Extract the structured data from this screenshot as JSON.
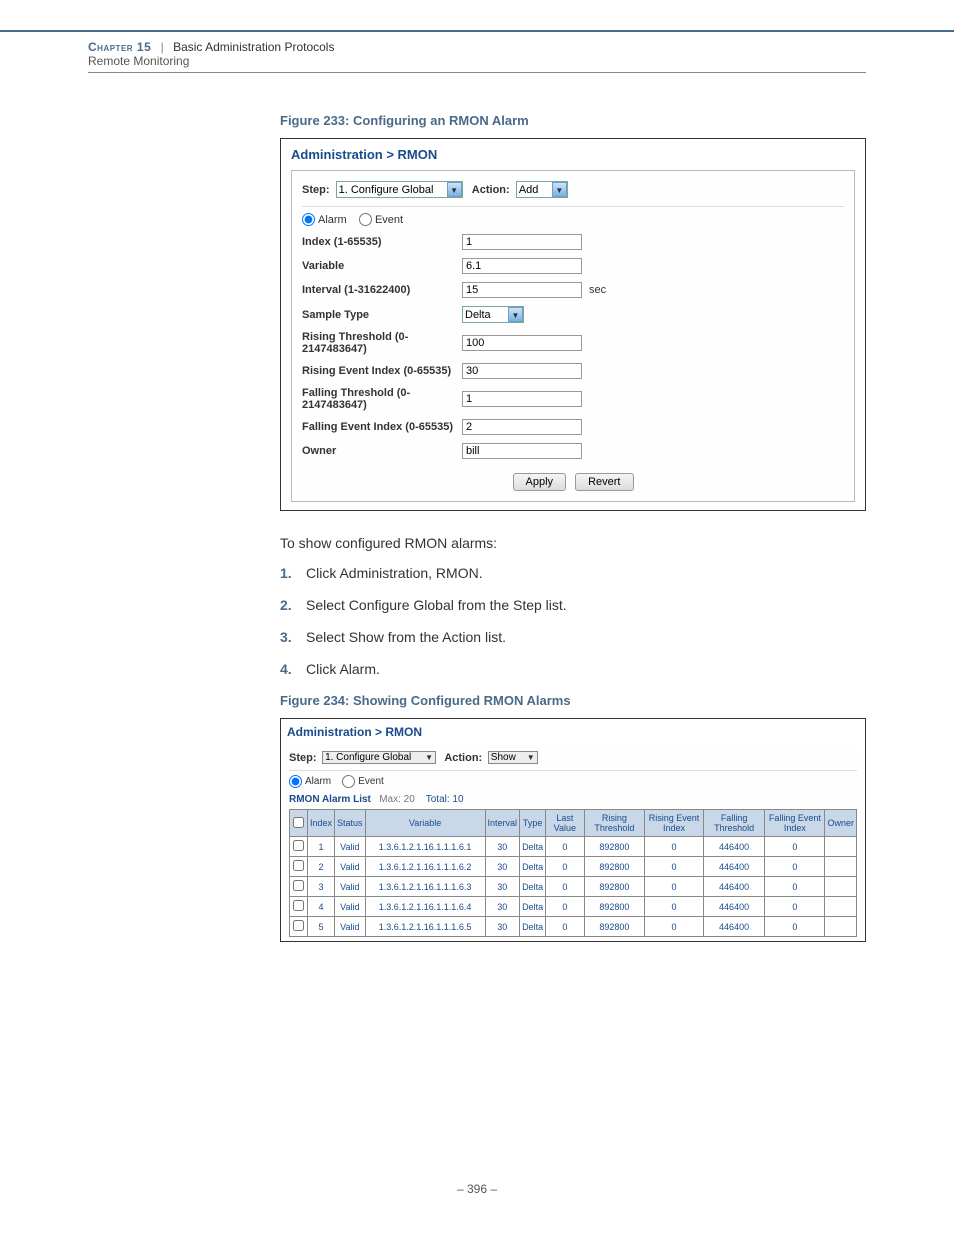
{
  "header": {
    "chapter_label": "Chapter 15",
    "section": "Basic Administration Protocols",
    "subtitle": "Remote Monitoring"
  },
  "fig233": {
    "caption": "Figure 233:  Configuring an RMON Alarm",
    "breadcrumb": "Administration > RMON",
    "step_label": "Step:",
    "step_value": "1. Configure Global",
    "action_label": "Action:",
    "action_value": "Add",
    "radio_alarm": "Alarm",
    "radio_event": "Event",
    "fields": {
      "index_label": "Index (1-65535)",
      "index_value": "1",
      "variable_label": "Variable",
      "variable_value": "6.1",
      "interval_label": "Interval (1-31622400)",
      "interval_value": "15",
      "interval_unit": "sec",
      "sample_label": "Sample Type",
      "sample_value": "Delta",
      "rthresh_label": "Rising Threshold (0-2147483647)",
      "rthresh_value": "100",
      "revent_label": "Rising Event Index (0-65535)",
      "revent_value": "30",
      "fthresh_label": "Falling Threshold (0-2147483647)",
      "fthresh_value": "1",
      "fevent_label": "Falling Event Index (0-65535)",
      "fevent_value": "2",
      "owner_label": "Owner",
      "owner_value": "bill"
    },
    "btn_apply": "Apply",
    "btn_revert": "Revert"
  },
  "instructions": {
    "intro": "To show configured RMON alarms:",
    "s1": "Click Administration, RMON.",
    "s2": "Select Configure Global from the Step list.",
    "s3": "Select Show from the Action list.",
    "s4": "Click Alarm."
  },
  "fig234": {
    "caption": "Figure 234:  Showing Configured RMON Alarms",
    "breadcrumb": "Administration > RMON",
    "step_label": "Step:",
    "step_value": "1. Configure Global",
    "action_label": "Action:",
    "action_value": "Show",
    "radio_alarm": "Alarm",
    "radio_event": "Event",
    "list_title": "RMON Alarm List",
    "list_max": "Max: 20",
    "list_total": "Total: 10",
    "cols": {
      "c1": "Index",
      "c2": "Status",
      "c3": "Variable",
      "c4": "Interval",
      "c5": "Type",
      "c6": "Last Value",
      "c7": "Rising Threshold",
      "c8": "Rising Event Index",
      "c9": "Falling Threshold",
      "c10": "Falling Event Index",
      "c11": "Owner"
    },
    "rows": [
      {
        "idx": "1",
        "status": "Valid",
        "var": "1.3.6.1.2.1.16.1.1.1.6.1",
        "intv": "30",
        "type": "Delta",
        "last": "0",
        "rth": "892800",
        "rei": "0",
        "fth": "446400",
        "fei": "0",
        "own": ""
      },
      {
        "idx": "2",
        "status": "Valid",
        "var": "1.3.6.1.2.1.16.1.1.1.6.2",
        "intv": "30",
        "type": "Delta",
        "last": "0",
        "rth": "892800",
        "rei": "0",
        "fth": "446400",
        "fei": "0",
        "own": ""
      },
      {
        "idx": "3",
        "status": "Valid",
        "var": "1.3.6.1.2.1.16.1.1.1.6.3",
        "intv": "30",
        "type": "Delta",
        "last": "0",
        "rth": "892800",
        "rei": "0",
        "fth": "446400",
        "fei": "0",
        "own": ""
      },
      {
        "idx": "4",
        "status": "Valid",
        "var": "1.3.6.1.2.1.16.1.1.1.6.4",
        "intv": "30",
        "type": "Delta",
        "last": "0",
        "rth": "892800",
        "rei": "0",
        "fth": "446400",
        "fei": "0",
        "own": ""
      },
      {
        "idx": "5",
        "status": "Valid",
        "var": "1.3.6.1.2.1.16.1.1.1.6.5",
        "intv": "30",
        "type": "Delta",
        "last": "0",
        "rth": "892800",
        "rei": "0",
        "fth": "446400",
        "fei": "0",
        "own": ""
      }
    ]
  },
  "footer": {
    "page": "– 396 –"
  }
}
